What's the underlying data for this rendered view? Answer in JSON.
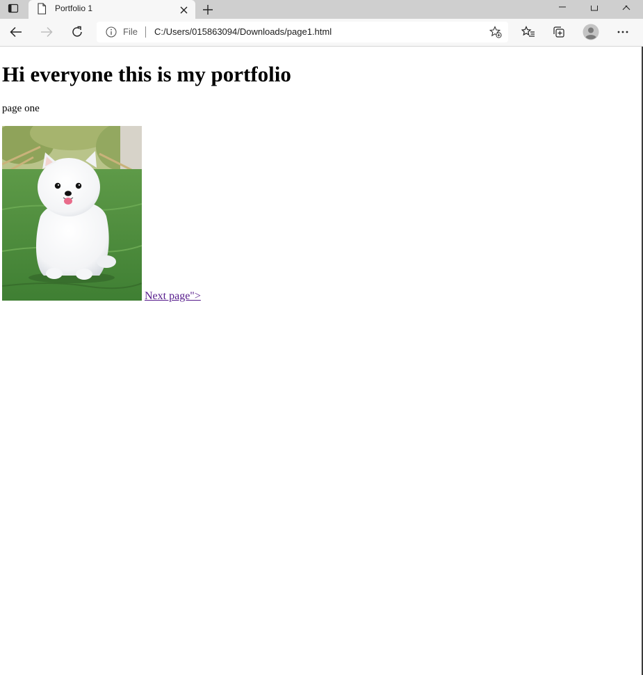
{
  "browser": {
    "tab": {
      "title": "Portfolio 1"
    },
    "address_bar": {
      "security_label": "File",
      "url": "C:/Users/015863094/Downloads/page1.html"
    }
  },
  "page": {
    "heading": "Hi everyone this is my portfolio",
    "text": "page one",
    "image_subject": "white pomeranian puppy on grass",
    "link_text": "Next page\">"
  },
  "icons": {
    "tab_actions": "tab-actions-icon",
    "tab_page": "page-icon",
    "tab_close": "close-icon",
    "new_tab": "plus-icon",
    "back": "back-arrow-icon",
    "forward": "forward-arrow-icon",
    "refresh": "refresh-icon",
    "info": "info-icon",
    "add_favorite": "star-plus-icon",
    "favorites": "favorites-icon",
    "collections": "collections-icon",
    "profile": "profile-icon",
    "more": "more-icon"
  },
  "colors": {
    "tab_strip": "#cfcfcf",
    "toolbar": "#f7f7f7",
    "visited_link": "#551a8b",
    "grass": "#4a8a3c",
    "background": "#ffffff"
  }
}
